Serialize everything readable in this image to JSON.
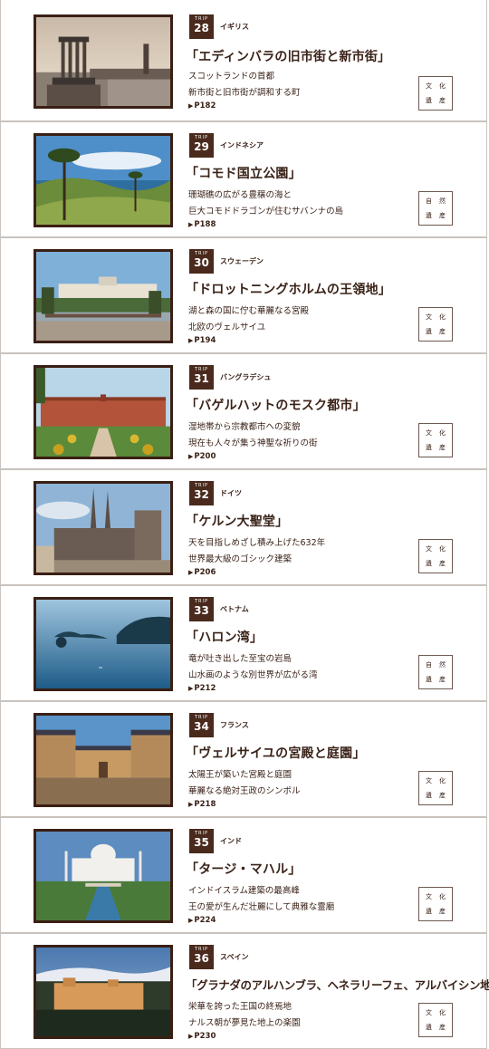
{
  "entries": [
    {
      "trip_label": "TRIP",
      "num": "28",
      "country": "イギリス",
      "title": "「エディンバラの旧市街と新市街」",
      "line1": "スコットランドの首都",
      "line2": "新市街と旧市街が調和する町",
      "page": "P182",
      "tag": [
        "文",
        "化",
        "遺",
        "産"
      ],
      "image": "edinburgh-thumbnail"
    },
    {
      "trip_label": "TRIP",
      "num": "29",
      "country": "インドネシア",
      "title": "「コモド国立公園」",
      "line1": "珊瑚礁の広がる豊穣の海と",
      "line2": "巨大コモドドラゴンが住むサバンナの島",
      "page": "P188",
      "tag": [
        "自",
        "然",
        "遺",
        "産"
      ],
      "image": "komodo-thumbnail"
    },
    {
      "trip_label": "TRIP",
      "num": "30",
      "country": "スウェーデン",
      "title": "「ドロットニングホルムの王領地」",
      "line1": "湖と森の国に佇む華麗なる宮殿",
      "line2": "北欧のヴェルサイユ",
      "page": "P194",
      "tag": [
        "文",
        "化",
        "遺",
        "産"
      ],
      "image": "drottningholm-thumbnail"
    },
    {
      "trip_label": "TRIP",
      "num": "31",
      "country": "バングラデシュ",
      "title": "「バゲルハットのモスク都市」",
      "line1": "湿地帯から宗教都市への変貌",
      "line2": "現在も人々が集う神聖な祈りの街",
      "page": "P200",
      "tag": [
        "文",
        "化",
        "遺",
        "産"
      ],
      "image": "bagerhat-thumbnail"
    },
    {
      "trip_label": "TRIP",
      "num": "32",
      "country": "ドイツ",
      "title": "「ケルン大聖堂」",
      "line1": "天を目指しめざし積み上げた632年",
      "line2": "世界最大級のゴシック建築",
      "page": "P206",
      "tag": [
        "文",
        "化",
        "遺",
        "産"
      ],
      "image": "cologne-cathedral-thumbnail"
    },
    {
      "trip_label": "TRIP",
      "num": "33",
      "country": "ベトナム",
      "title": "「ハロン湾」",
      "line1": "竜が吐き出した至宝の岩島",
      "line2": "山水画のような別世界が広がる湾",
      "page": "P212",
      "tag": [
        "自",
        "然",
        "遺",
        "産"
      ],
      "image": "halong-bay-thumbnail"
    },
    {
      "trip_label": "TRIP",
      "num": "34",
      "country": "フランス",
      "title": "「ヴェルサイユの宮殿と庭園」",
      "line1": "太陽王が築いた宮殿と庭園",
      "line2": "華麗なる絶対王政のシンボル",
      "page": "P218",
      "tag": [
        "文",
        "化",
        "遺",
        "産"
      ],
      "image": "versailles-thumbnail"
    },
    {
      "trip_label": "TRIP",
      "num": "35",
      "country": "インド",
      "title": "「タージ・マハル」",
      "line1": "インドイスラム建築の最高峰",
      "line2": "王の愛が生んだ壮麗にして典雅な霊廟",
      "page": "P224",
      "tag": [
        "文",
        "化",
        "遺",
        "産"
      ],
      "image": "taj-mahal-thumbnail"
    },
    {
      "trip_label": "TRIP",
      "num": "36",
      "country": "スペイン",
      "title": "「グラナダのアルハンブラ、ヘネラリーフェ、アルバイシン地区」",
      "line1": "栄華を誇った王国の終焉地",
      "line2": "ナルス朝が夢見た地上の楽園",
      "page": "P230",
      "tag": [
        "文",
        "化",
        "遺",
        "産"
      ],
      "image": "alhambra-thumbnail"
    }
  ]
}
